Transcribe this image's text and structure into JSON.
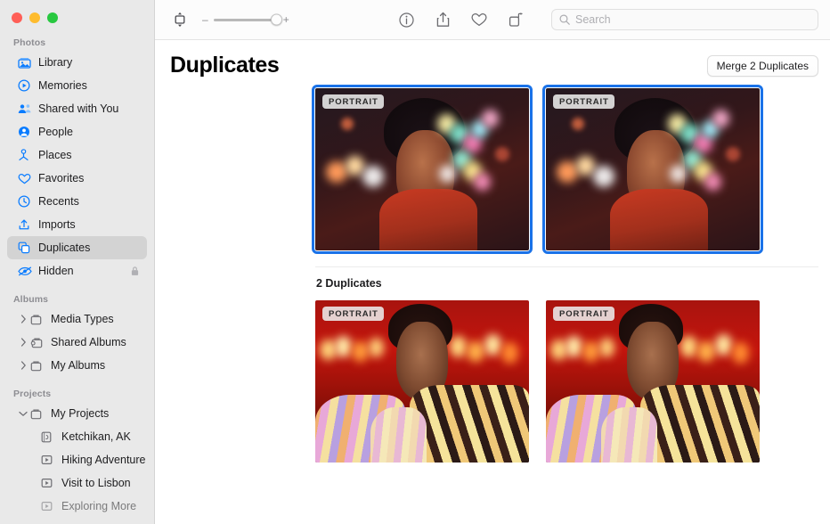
{
  "window": {
    "traffic_lights": [
      "close",
      "minimize",
      "zoom"
    ],
    "colors": {
      "close": "#ff5f57",
      "minimize": "#febc2e",
      "zoom": "#28c840",
      "accent": "#1a72e8",
      "icon_blue": "#0a7cff"
    }
  },
  "sidebar": {
    "sections": [
      {
        "title": "Photos",
        "items": [
          {
            "label": "Library",
            "icon": "library-icon",
            "selected": false
          },
          {
            "label": "Memories",
            "icon": "memories-icon",
            "selected": false
          },
          {
            "label": "Shared with You",
            "icon": "shared-with-you-icon",
            "selected": false
          },
          {
            "label": "People",
            "icon": "people-icon",
            "selected": false
          },
          {
            "label": "Places",
            "icon": "places-icon",
            "selected": false
          },
          {
            "label": "Favorites",
            "icon": "heart-icon",
            "selected": false
          },
          {
            "label": "Recents",
            "icon": "clock-icon",
            "selected": false
          },
          {
            "label": "Imports",
            "icon": "import-icon",
            "selected": false
          },
          {
            "label": "Duplicates",
            "icon": "duplicates-icon",
            "selected": true
          },
          {
            "label": "Hidden",
            "icon": "hidden-eye-icon",
            "selected": false,
            "trailing_icon": "lock-icon"
          }
        ]
      },
      {
        "title": "Albums",
        "items": [
          {
            "label": "Media Types",
            "icon": "folder-icon",
            "disclosure": "collapsed"
          },
          {
            "label": "Shared Albums",
            "icon": "shared-folder-icon",
            "disclosure": "collapsed"
          },
          {
            "label": "My Albums",
            "icon": "folder-icon",
            "disclosure": "collapsed"
          }
        ]
      },
      {
        "title": "Projects",
        "items": [
          {
            "label": "My Projects",
            "icon": "folder-icon",
            "disclosure": "expanded"
          },
          {
            "label": "Ketchikan, AK",
            "icon": "book-project-icon",
            "indent": 1
          },
          {
            "label": "Hiking Adventure",
            "icon": "slideshow-icon",
            "indent": 1
          },
          {
            "label": "Visit to Lisbon",
            "icon": "slideshow-icon",
            "indent": 1
          },
          {
            "label": "Exploring More",
            "icon": "slideshow-icon",
            "indent": 1,
            "clipped": true
          }
        ]
      }
    ]
  },
  "toolbar": {
    "view_options_icon": "view-options-icon",
    "zoom_out_label": "–",
    "zoom_in_label": "+",
    "zoom_value": 100,
    "actions": [
      {
        "name": "info-icon",
        "label": "Info"
      },
      {
        "name": "share-icon",
        "label": "Share"
      },
      {
        "name": "favorite-heart-icon",
        "label": "Favorite"
      },
      {
        "name": "rotate-icon",
        "label": "Rotate"
      }
    ],
    "search": {
      "placeholder": "Search",
      "value": ""
    }
  },
  "content": {
    "page_title": "Duplicates",
    "merge_button_label": "Merge 2 Duplicates",
    "group_count_label": "2 Duplicates",
    "groups": [
      {
        "selected": true,
        "photos": [
          {
            "badge": "PORTRAIT",
            "alt": "woman-with-bokeh-lights",
            "variant": "a",
            "selected": true
          },
          {
            "badge": "PORTRAIT",
            "alt": "woman-with-bokeh-lights",
            "variant": "a",
            "selected": true
          }
        ]
      },
      {
        "selected": false,
        "photos": [
          {
            "badge": "PORTRAIT",
            "alt": "man-in-striped-sweater",
            "variant": "b",
            "selected": false
          },
          {
            "badge": "PORTRAIT",
            "alt": "man-in-striped-sweater",
            "variant": "b",
            "selected": false
          }
        ]
      }
    ]
  }
}
